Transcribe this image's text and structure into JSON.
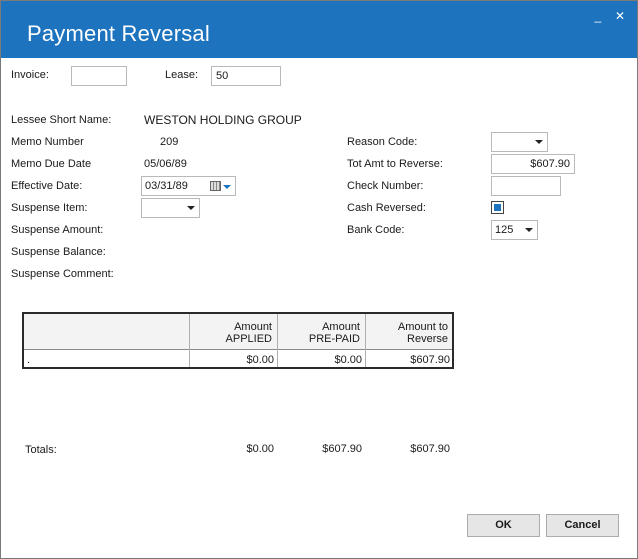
{
  "window": {
    "title": "Payment Reversal",
    "minimize_glyph": "_",
    "close_glyph": "✕"
  },
  "header_fields": {
    "invoice_label": "Invoice:",
    "invoice_value": "",
    "lease_label": "Lease:",
    "lease_value": "50"
  },
  "left_fields": {
    "lessee_label": "Lessee Short Name:",
    "lessee_value": "WESTON HOLDING GROUP",
    "memo_number_label": "Memo Number",
    "memo_number_value": "209",
    "memo_due_label": "Memo Due Date",
    "memo_due_value": "05/06/89",
    "effective_label": "Effective Date:",
    "effective_value": "03/31/89",
    "suspense_item_label": "Suspense Item:",
    "suspense_item_value": "",
    "suspense_amount_label": "Suspense Amount:",
    "suspense_balance_label": "Suspense Balance:",
    "suspense_comment_label": "Suspense Comment:"
  },
  "right_fields": {
    "reason_code_label": "Reason Code:",
    "reason_code_value": "",
    "tot_amt_label": "Tot Amt to Reverse:",
    "tot_amt_value": "$607.90",
    "check_number_label": "Check Number:",
    "check_number_value": "",
    "cash_reversed_label": "Cash Reversed:",
    "cash_reversed_checked": true,
    "bank_code_label": "Bank Code:",
    "bank_code_value": "125"
  },
  "grid": {
    "headers": [
      {
        "line1": "Amount",
        "line2": "APPLIED"
      },
      {
        "line1": "Amount",
        "line2": "PRE-PAID"
      },
      {
        "line1": "Amount to",
        "line2": "Reverse"
      }
    ],
    "row": {
      "first": ".",
      "applied": "$0.00",
      "prepaid": "$0.00",
      "reverse": "$607.90"
    }
  },
  "totals": {
    "label": "Totals:",
    "applied": "$0.00",
    "prepaid": "$607.90",
    "reverse": "$607.90"
  },
  "buttons": {
    "ok": "OK",
    "cancel": "Cancel"
  },
  "colors": {
    "accent": "#1e73be"
  }
}
